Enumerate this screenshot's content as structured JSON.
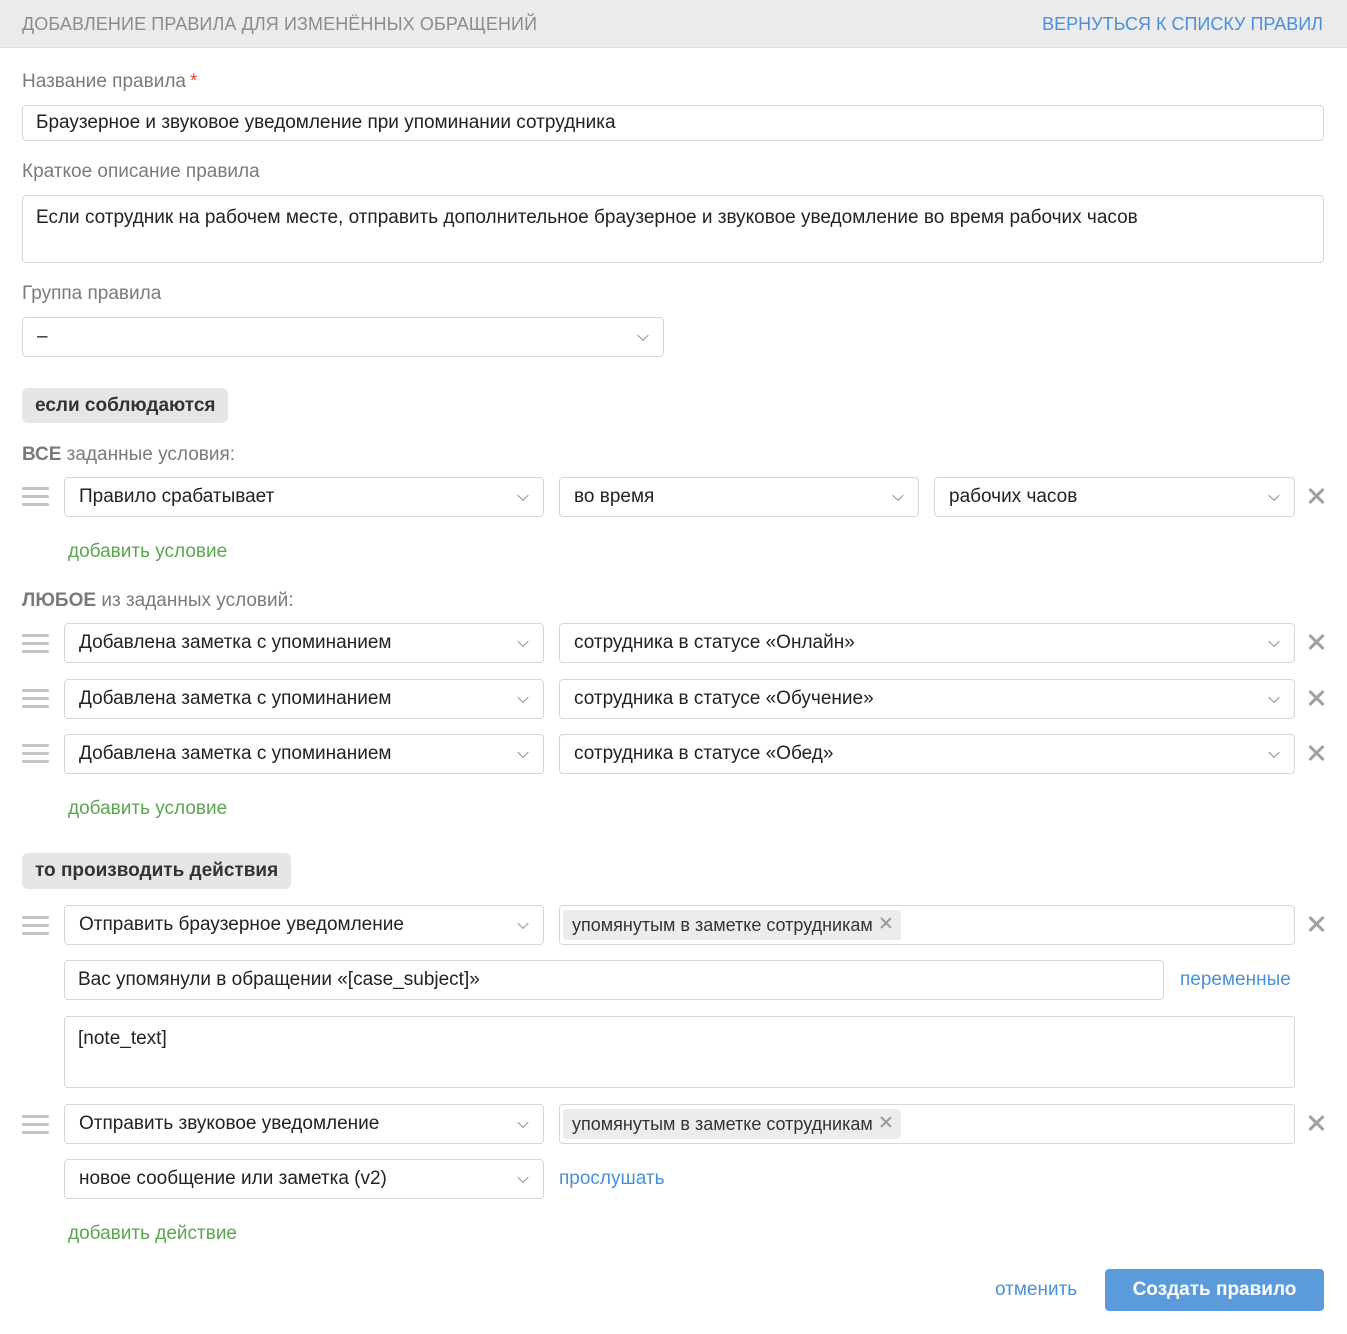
{
  "header": {
    "title": "Добавление правила для изменённых обращений",
    "back_link": "Вернуться к списку правил"
  },
  "form": {
    "name_label": "Название правила",
    "required_mark": "*",
    "name_value": "Браузерное и звуковое уведомление при упоминании сотрудника",
    "description_label": "Краткое описание правила",
    "description_value": "Если сотрудник на рабочем месте, отправить дополнительное браузерное и звуковое уведомление во время рабочих часов",
    "group_label": "Группа правила",
    "group_value": "–"
  },
  "conditions": {
    "section_pill": "если соблюдаются",
    "all_label_bold": "ВСЕ",
    "all_label_rest": " заданные условия:",
    "all_rows": [
      {
        "field": "Правило срабатывает",
        "operator": "во время",
        "value": "рабочих часов"
      }
    ],
    "add_condition_all": "добавить условие",
    "any_label_bold": "ЛЮБОЕ",
    "any_label_rest": " из заданных условий:",
    "any_rows": [
      {
        "field": "Добавлена заметка с упоминанием",
        "value": "сотрудника в статусе «Онлайн»"
      },
      {
        "field": "Добавлена заметка с упоминанием",
        "value": "сотрудника в статусе «Обучение»"
      },
      {
        "field": "Добавлена заметка с упоминанием",
        "value": "сотрудника в статусе «Обед»"
      }
    ],
    "add_condition_any": "добавить условие"
  },
  "actions": {
    "section_pill": "то производить действия",
    "browser": {
      "action": "Отправить браузерное уведомление",
      "recipient_tag": "упомянутым в заметке сотрудникам",
      "title_value": "Вас упомянули в обращении «[case_subject]»",
      "variables_link": "переменные",
      "body_value": "[note_text]"
    },
    "sound": {
      "action": "Отправить звуковое уведомление",
      "recipient_tag": "упомянутым в заметке сотрудникам",
      "sound_value": "новое сообщение или заметка (v2)",
      "listen_link": "прослушать"
    },
    "add_action": "добавить действие"
  },
  "footer": {
    "cancel": "отменить",
    "submit": "Создать правило"
  },
  "colors": {
    "accent_blue": "#4a90d9",
    "button_blue": "#5b9bdc",
    "link_green": "#5aa64f",
    "required_red": "#e0463a"
  }
}
